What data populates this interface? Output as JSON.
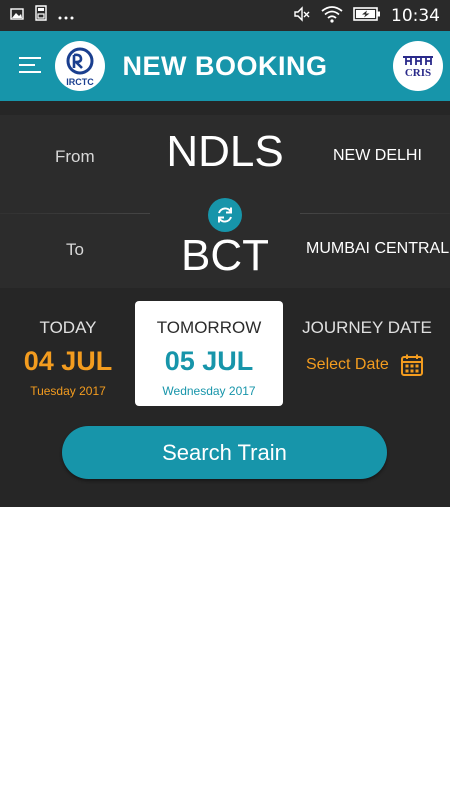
{
  "status_bar": {
    "time": "10:34",
    "left_icons": [
      "gallery-icon",
      "storage-icon",
      "more-dots-icon"
    ],
    "right_icons": [
      "mute-icon",
      "wifi-icon",
      "battery-charging-icon"
    ]
  },
  "app_bar": {
    "title": "NEW BOOKING",
    "left_logo_text": "IRCTC",
    "right_logo_text": "CRIS",
    "color": "#1795aa"
  },
  "route": {
    "from_label": "From",
    "from_code": "NDLS",
    "from_city": "NEW DELHI",
    "to_label": "To",
    "to_code": "BCT",
    "to_city": "MUMBAI CENTRAL"
  },
  "dates": {
    "today": {
      "label": "TODAY",
      "date": "04 JUL",
      "weekday": "Tuesday 2017",
      "color": "#f39c1f"
    },
    "tomorrow": {
      "label": "TOMORROW",
      "date": "05 JUL",
      "weekday": "Wednesday 2017",
      "color": "#1795aa",
      "selected": true
    },
    "journey": {
      "label": "JOURNEY DATE",
      "select_text": "Select Date",
      "color": "#f39c1f"
    }
  },
  "search_button_label": "Search Train"
}
